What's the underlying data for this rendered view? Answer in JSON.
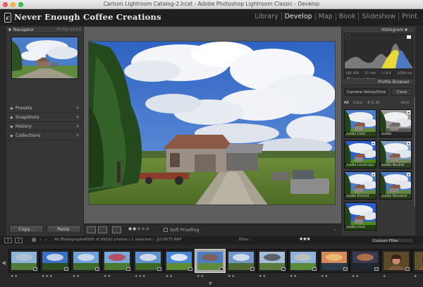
{
  "window": {
    "title": "Carlson Lightroom Catalog-2.lrcat - Adobe Photoshop Lightroom Classic - Develop"
  },
  "identity": {
    "logo_text": "Never Enough Coffee Creations"
  },
  "modules": [
    "Library",
    "Develop",
    "Map",
    "Book",
    "Slideshow",
    "Print"
  ],
  "active_module": "Develop",
  "left_panel": {
    "navigator": {
      "label": "Navigator",
      "zoom_options": [
        "FIT",
        "FILL",
        "1:1",
        "4:1"
      ]
    },
    "sections": [
      {
        "label": "Presets",
        "has_add": true
      },
      {
        "label": "Snapshots",
        "has_add": true
      },
      {
        "label": "History",
        "has_add": false
      },
      {
        "label": "Collections",
        "has_add": true
      }
    ],
    "copy_label": "Copy...",
    "paste_label": "Paste"
  },
  "toolbar": {
    "rating": 2,
    "max_rating": 5,
    "soft_proofing_label": "Soft Proofing",
    "soft_proofing_checked": false
  },
  "right_panel": {
    "histogram": {
      "label": "Histogram",
      "info": [
        "ISO 100",
        "27 mm",
        "f / 8.0",
        "1/250 sec"
      ],
      "original_photo_label": "Original Photo"
    },
    "profile_browser": {
      "label": "Profile Browser",
      "selected_group": "Camera Velvia/Vivid",
      "close_label": "Close",
      "tabs": [
        "All",
        "Color",
        "B & W"
      ],
      "active_tab": "All",
      "grid_label": "Grid",
      "profiles": [
        {
          "name": "Adobe Color",
          "favorite": false,
          "style": "color"
        },
        {
          "name": "Adobe Monochrome",
          "favorite": true,
          "style": "mono"
        },
        {
          "name": "Adobe Landscape",
          "favorite": true,
          "style": "vivid"
        },
        {
          "name": "Adobe Neutral",
          "favorite": true,
          "style": "neutral"
        },
        {
          "name": "Adobe Portrait",
          "favorite": true,
          "style": "color"
        },
        {
          "name": "Adobe Standard",
          "favorite": true,
          "style": "color"
        },
        {
          "name": "Adobe Vivid",
          "favorite": false,
          "style": "vivid"
        }
      ]
    }
  },
  "filmstrip_bar": {
    "screen_buttons": [
      "1",
      "2"
    ],
    "source_label": "All Photographs",
    "count_label": "8585 of 99192 photos / 1 selected / _JLC0675.RAF",
    "filter_label": "Filter :",
    "filter_stars": "★★★",
    "custom_filter_label": "Custom Filter"
  },
  "filmstrip": {
    "thumbnails": [
      {
        "subject": "road-reflection",
        "rating_dots": "★★",
        "selected": false
      },
      {
        "subject": "sky-tree",
        "rating_dots": "★★★",
        "selected": false
      },
      {
        "subject": "trees-field",
        "rating_dots": "★★",
        "selected": false
      },
      {
        "subject": "red-flowers",
        "rating_dots": "★★",
        "selected": false
      },
      {
        "subject": "tree-field",
        "rating_dots": "★★★",
        "selected": false
      },
      {
        "subject": "sky-field",
        "rating_dots": "★★",
        "selected": false
      },
      {
        "subject": "barn-field",
        "rating_dots": "★★",
        "selected": true
      },
      {
        "subject": "tree-farm",
        "rating_dots": "★★",
        "selected": false
      },
      {
        "subject": "windmill",
        "rating_dots": "★★",
        "selected": false
      },
      {
        "subject": "field-path",
        "rating_dots": "★★",
        "selected": false
      },
      {
        "subject": "sunset-water",
        "rating_dots": "★★",
        "selected": false
      },
      {
        "subject": "sunset-dark",
        "rating_dots": "★★",
        "selected": false
      },
      {
        "subject": "portrait-1",
        "rating_dots": "★",
        "selected": false
      },
      {
        "subject": "portrait-2",
        "rating_dots": "★",
        "selected": false
      }
    ]
  },
  "colors": {
    "accent": "#e8e8e8",
    "panel": "#363636",
    "background": "#282828",
    "histogram_yellow": "#e8d83a",
    "histogram_blue": "#4d79c7"
  }
}
